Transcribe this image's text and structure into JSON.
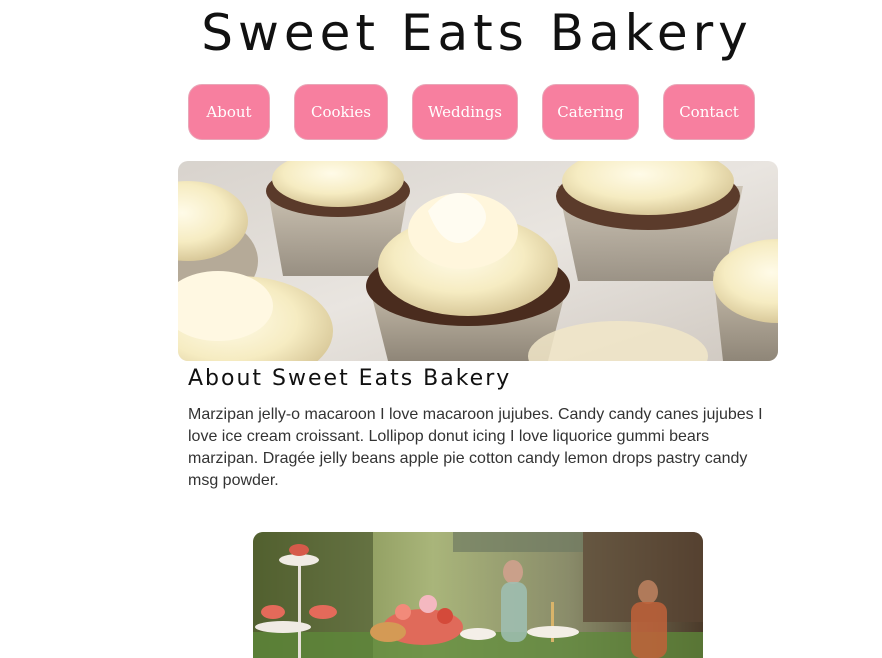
{
  "header": {
    "title": "Sweet Eats Bakery"
  },
  "nav": {
    "items": [
      {
        "label": "About"
      },
      {
        "label": "Cookies"
      },
      {
        "label": "Weddings"
      },
      {
        "label": "Catering"
      },
      {
        "label": "Contact"
      }
    ]
  },
  "about": {
    "heading": "About Sweet Eats Bakery",
    "body": "Marzipan jelly-o macaroon I love macaroon jujubes. Candy candy canes jujubes I love ice cream croissant. Lollipop donut icing I love liquorice gummi bears marzipan. Dragée jelly beans apple pie cotton candy lemon drops pastry candy msg powder."
  },
  "colors": {
    "nav_button": "#f77f9f",
    "nav_text": "#ffffff",
    "heading": "#111111",
    "body_text": "#333333"
  }
}
